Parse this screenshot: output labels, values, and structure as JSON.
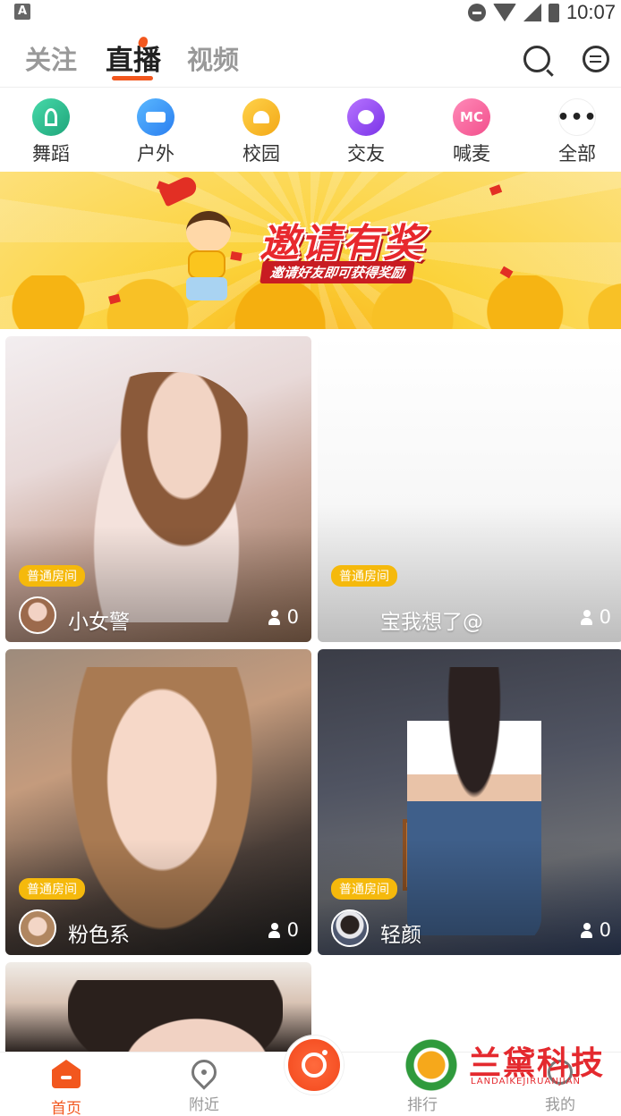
{
  "status_bar": {
    "notification_icon": "A",
    "time": "10:07",
    "icons": [
      "do-not-disturb-icon",
      "wifi-icon",
      "signal-icon",
      "battery-icon"
    ]
  },
  "top_nav": {
    "tabs": [
      {
        "label": "关注",
        "active": false
      },
      {
        "label": "直播",
        "active": true
      },
      {
        "label": "视频",
        "active": false
      }
    ],
    "accent_color": "#f2571e",
    "icons": [
      "search-icon",
      "message-icon"
    ]
  },
  "categories": [
    {
      "label": "舞蹈",
      "icon": "dance-icon",
      "color": "#1fa57a"
    },
    {
      "label": "户外",
      "icon": "outdoor-icon",
      "color": "#2a7ef0"
    },
    {
      "label": "校园",
      "icon": "campus-icon",
      "color": "#f3a816"
    },
    {
      "label": "交友",
      "icon": "friend-icon",
      "color": "#7a33e8"
    },
    {
      "label": "喊麦",
      "icon": "mc-icon",
      "icon_text": "MC",
      "color": "#f24f8c"
    },
    {
      "label": "全部",
      "icon": "more-icon",
      "icon_text": "•••",
      "color": "#ffffff"
    }
  ],
  "banner": {
    "title": "邀请有奖",
    "subtitle": "邀请好友即可获得奖励"
  },
  "rooms": [
    {
      "badge": "普通房间",
      "name": "小女警",
      "viewers": "0"
    },
    {
      "badge": "普通房间",
      "name": "宝我想了@",
      "viewers": "0"
    },
    {
      "badge": "普通房间",
      "name": "粉色系",
      "viewers": "0"
    },
    {
      "badge": "普通房间",
      "name": "轻颜",
      "viewers": "0"
    }
  ],
  "bottom_nav": {
    "items": [
      {
        "label": "首页",
        "icon": "home-icon",
        "active": true
      },
      {
        "label": "附近",
        "icon": "location-icon",
        "active": false
      },
      {
        "label": "排行",
        "icon": "ranking-icon",
        "active": false
      },
      {
        "label": "我的",
        "icon": "profile-icon",
        "active": false
      }
    ],
    "live_button_icon": "camera-icon"
  },
  "watermark": {
    "cn": "兰黛科技",
    "en": "LANDAIKEJIRUANJIAN"
  }
}
